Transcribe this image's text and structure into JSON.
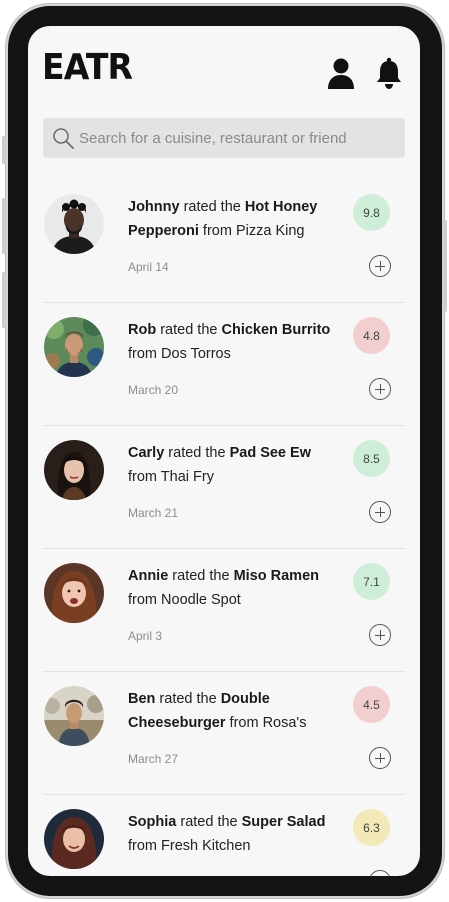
{
  "app": {
    "logo": "EATR",
    "icons": {
      "profile": "user-icon",
      "notifications": "bell-icon",
      "search": "search-icon"
    }
  },
  "search": {
    "placeholder": "Search for a cuisine, restaurant or friend"
  },
  "feed": [
    {
      "user": "Johnny",
      "mid": " rated the ",
      "dish": "Hot Honey Pepperoni",
      "from": " from Pizza King",
      "date": "April 14",
      "score": "9.8",
      "score_color": "#cfeeda"
    },
    {
      "user": "Rob",
      "mid": " rated the ",
      "dish": "Chicken Burrito",
      "from": " from Dos Torros",
      "date": "March 20",
      "score": "4.8",
      "score_color": "#f1cfcf"
    },
    {
      "user": "Carly",
      "mid": " rated the ",
      "dish": "Pad See Ew",
      "from": " from Thai Fry",
      "date": "March 21",
      "score": "8.5",
      "score_color": "#cfeeda"
    },
    {
      "user": "Annie",
      "mid": " rated the ",
      "dish": "Miso Ramen",
      "from": " from Noodle Spot",
      "date": "April 3",
      "score": "7.1",
      "score_color": "#cfeeda"
    },
    {
      "user": "Ben",
      "mid": " rated the ",
      "dish": "Double Cheeseburger",
      "from": " from Rosa's",
      "date": "March 27",
      "score": "4.5",
      "score_color": "#f1cfcf"
    },
    {
      "user": "Sophia",
      "mid": " rated the ",
      "dish": "Super Salad",
      "from": " from Fresh Kitchen",
      "date": "",
      "score": "6.3",
      "score_color": "#f2e8b8"
    }
  ],
  "colors": {
    "positive": "#cfeeda",
    "negative": "#f1cfcf",
    "neutral": "#f2e8b8"
  }
}
